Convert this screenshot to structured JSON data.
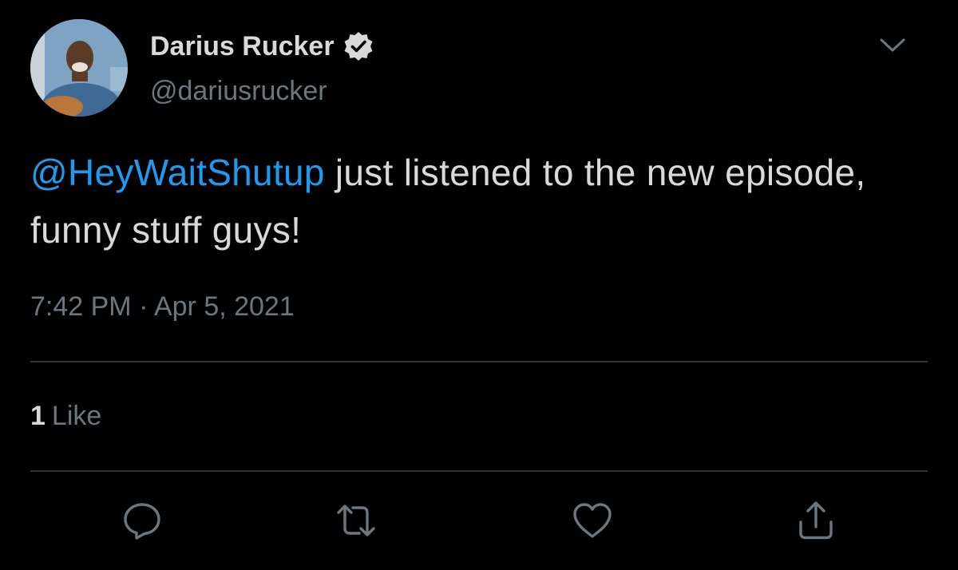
{
  "author": {
    "display_name": "Darius Rucker",
    "handle": "@dariusrucker",
    "verified": true,
    "avatar_icon": "profile-photo"
  },
  "tweet": {
    "mention": "@HeyWaitShutup",
    "text": " just listened to the new episode, funny stuff guys!",
    "timestamp": "7:42 PM · Apr 5, 2021"
  },
  "engagement": {
    "likes_count": "1",
    "likes_label": "Like"
  },
  "actions": {
    "reply_icon": "reply-icon",
    "retweet_icon": "retweet-icon",
    "like_icon": "heart-icon",
    "share_icon": "share-icon",
    "more_icon": "chevron-down-icon"
  },
  "colors": {
    "background": "#000000",
    "text": "#d9d9d9",
    "muted": "#6e767d",
    "link": "#1d9bf0",
    "divider": "#2f3336"
  }
}
